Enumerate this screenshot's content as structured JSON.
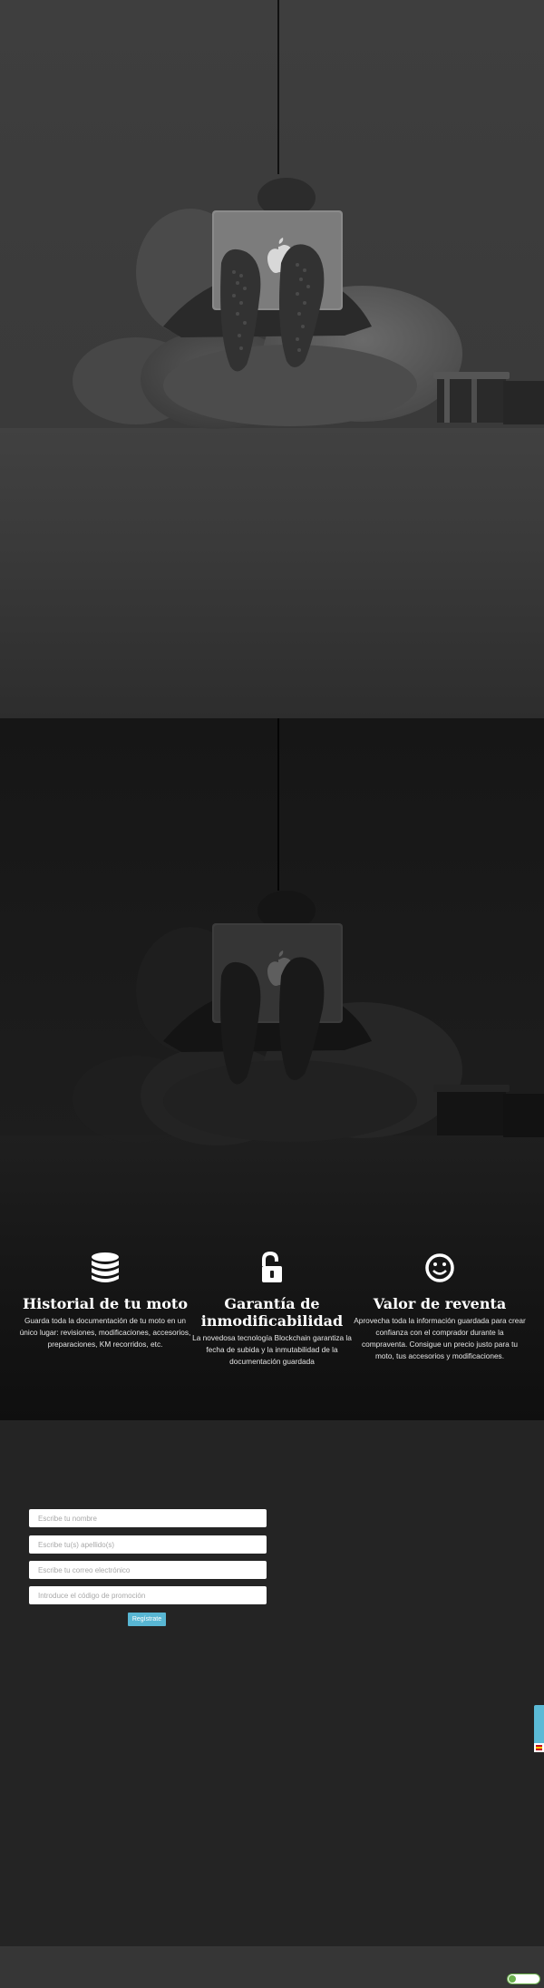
{
  "features": [
    {
      "icon": "database-icon",
      "title": "Historial de tu moto",
      "text": "Guarda toda la documentación de tu moto en un único lugar: revisiones, modificaciones, accesorios, preparaciones, KM recorridos, etc."
    },
    {
      "icon": "unlock-icon",
      "title": "Garantía de inmodificabilidad",
      "text": "La novedosa tecnología Blockchain garantiza la fecha de subida y la inmutabilidad de la documentación guardada"
    },
    {
      "icon": "smile-icon",
      "title": "Valor de reventa",
      "text": "Aprovecha toda la información guardada para crear confianza con el comprador durante la compraventa. Consigue un precio justo para tu moto, tus accesorios y modificaciones."
    }
  ],
  "form": {
    "name_placeholder": "Escribe tu nombre",
    "surname_placeholder": "Escribe tu(s) apellido(s)",
    "email_placeholder": "Escribe tu correo electrónico",
    "promo_placeholder": "Introduce el código de promoción",
    "submit_label": "Regístrate"
  },
  "colors": {
    "accent": "#58b6d3",
    "background": "#242424",
    "footer": "#363636"
  }
}
